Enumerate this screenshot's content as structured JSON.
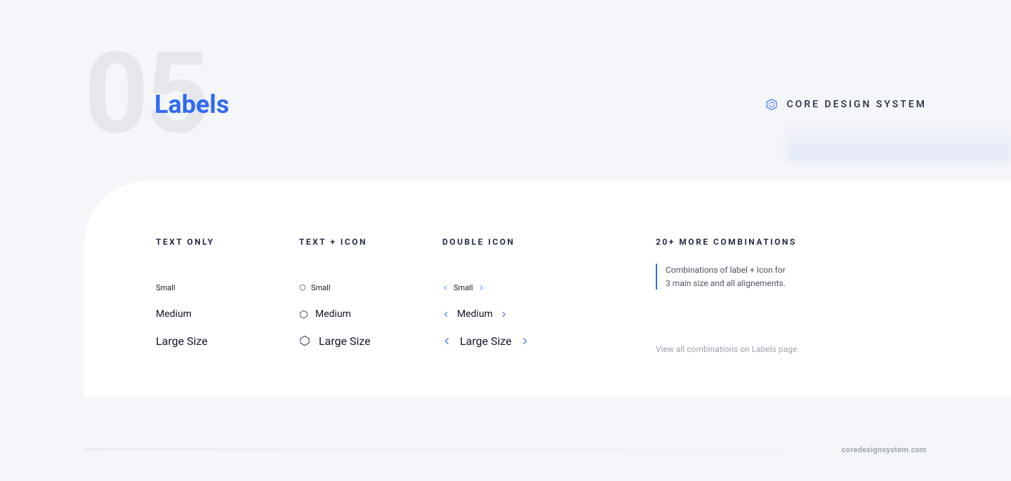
{
  "header": {
    "section_number": "05",
    "title": "Labels",
    "brand": "CORE DESIGN SYSTEM"
  },
  "columns": {
    "text_only": {
      "header": "TEXT ONLY",
      "items": [
        "Small",
        "Medium",
        "Large Size"
      ]
    },
    "text_icon": {
      "header": "TEXT + ICON",
      "items": [
        "Small",
        "Medium",
        "Large Size"
      ]
    },
    "double_icon": {
      "header": "DOUBLE ICON",
      "items": [
        "Small",
        "Medium",
        "Large Size"
      ]
    },
    "more": {
      "header": "20+ MORE COMBINATIONS",
      "description_line1": "Combinations of label + Icon for",
      "description_line2": "3 main size and all alignements.",
      "view_all": "View all combinations on Labels page."
    }
  },
  "footer": {
    "url": "coredesignsystem.com"
  },
  "colors": {
    "accent": "#2f6af6",
    "text_dark": "#1f2a44",
    "muted": "#9ca3af"
  }
}
